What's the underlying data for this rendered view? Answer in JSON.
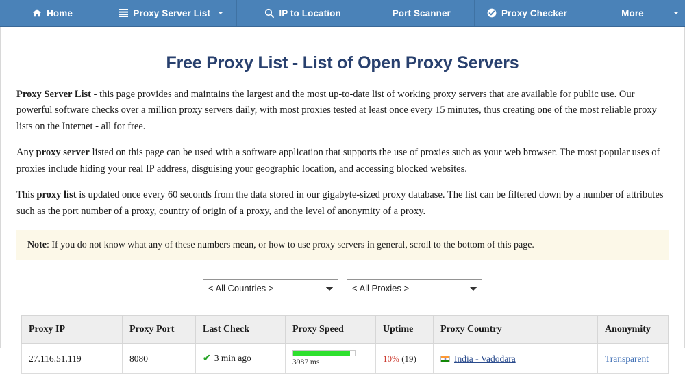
{
  "nav": {
    "items": [
      {
        "label": "Home",
        "icon": "home-icon",
        "caret": false
      },
      {
        "label": "Proxy Server List",
        "icon": "list-icon",
        "caret": true
      },
      {
        "label": "IP to Location",
        "icon": "magnifier-icon",
        "caret": false
      },
      {
        "label": "Port Scanner",
        "icon": "none",
        "caret": false
      },
      {
        "label": "Proxy Checker",
        "icon": "check-circle-icon",
        "caret": false
      },
      {
        "label": "More",
        "icon": "none",
        "caret": true
      }
    ]
  },
  "header": {
    "title": "Free Proxy List - List of Open Proxy Servers"
  },
  "intro": {
    "p1_lead": "Proxy Server List",
    "p1_rest": " - this page provides and maintains the largest and the most up-to-date list of working proxy servers that are available for public use. Our powerful software checks over a million proxy servers daily, with most proxies tested at least once every 15 minutes, thus creating one of the most reliable proxy lists on the Internet - all for free.",
    "p2_pre": "Any ",
    "p2_lead": "proxy server",
    "p2_rest": " listed on this page can be used with a software application that supports the use of proxies such as your web browser. The most popular uses of proxies include hiding your real IP address, disguising your geographic location, and accessing blocked websites.",
    "p3_pre": "This ",
    "p3_lead": "proxy list",
    "p3_rest": " is updated once every 60 seconds from the data stored in our gigabyte-sized proxy database. The list can be filtered down by a number of attributes such as the port number of a proxy, country of origin of a proxy, and the level of anonymity of a proxy."
  },
  "note": {
    "label": "Note",
    "text": ": If you do not know what any of these numbers mean, or how to use proxy servers in general, scroll to the bottom of this page."
  },
  "filters": {
    "country": {
      "selected": "< All Countries >",
      "options": [
        "< All Countries >"
      ]
    },
    "proxy": {
      "selected": "< All Proxies >",
      "options": [
        "< All Proxies >"
      ]
    }
  },
  "table": {
    "columns": [
      "Proxy IP",
      "Proxy Port",
      "Last Check",
      "Proxy Speed",
      "Uptime",
      "Proxy Country",
      "Anonymity"
    ],
    "rows": [
      {
        "ip": "27.116.51.119",
        "port": "8080",
        "last_check": "3 min ago",
        "last_check_icon": "green-check-icon",
        "speed_ms": "3987 ms",
        "speed_percent": 92,
        "uptime_pct": "10%",
        "uptime_count": "(19)",
        "country": "India - Vadodara",
        "country_flag": "india-flag-icon",
        "anonymity": "Transparent"
      }
    ]
  },
  "colors": {
    "navbar": "#4a82b8",
    "navbar_border": "#3a6897",
    "title": "#28406e",
    "note_bg": "#fcf8e8",
    "speed_green": "#2ee02e",
    "uptime_red": "#cc3b30",
    "link_blue": "#2a4b8d",
    "anon_blue": "#3f6fb5"
  }
}
